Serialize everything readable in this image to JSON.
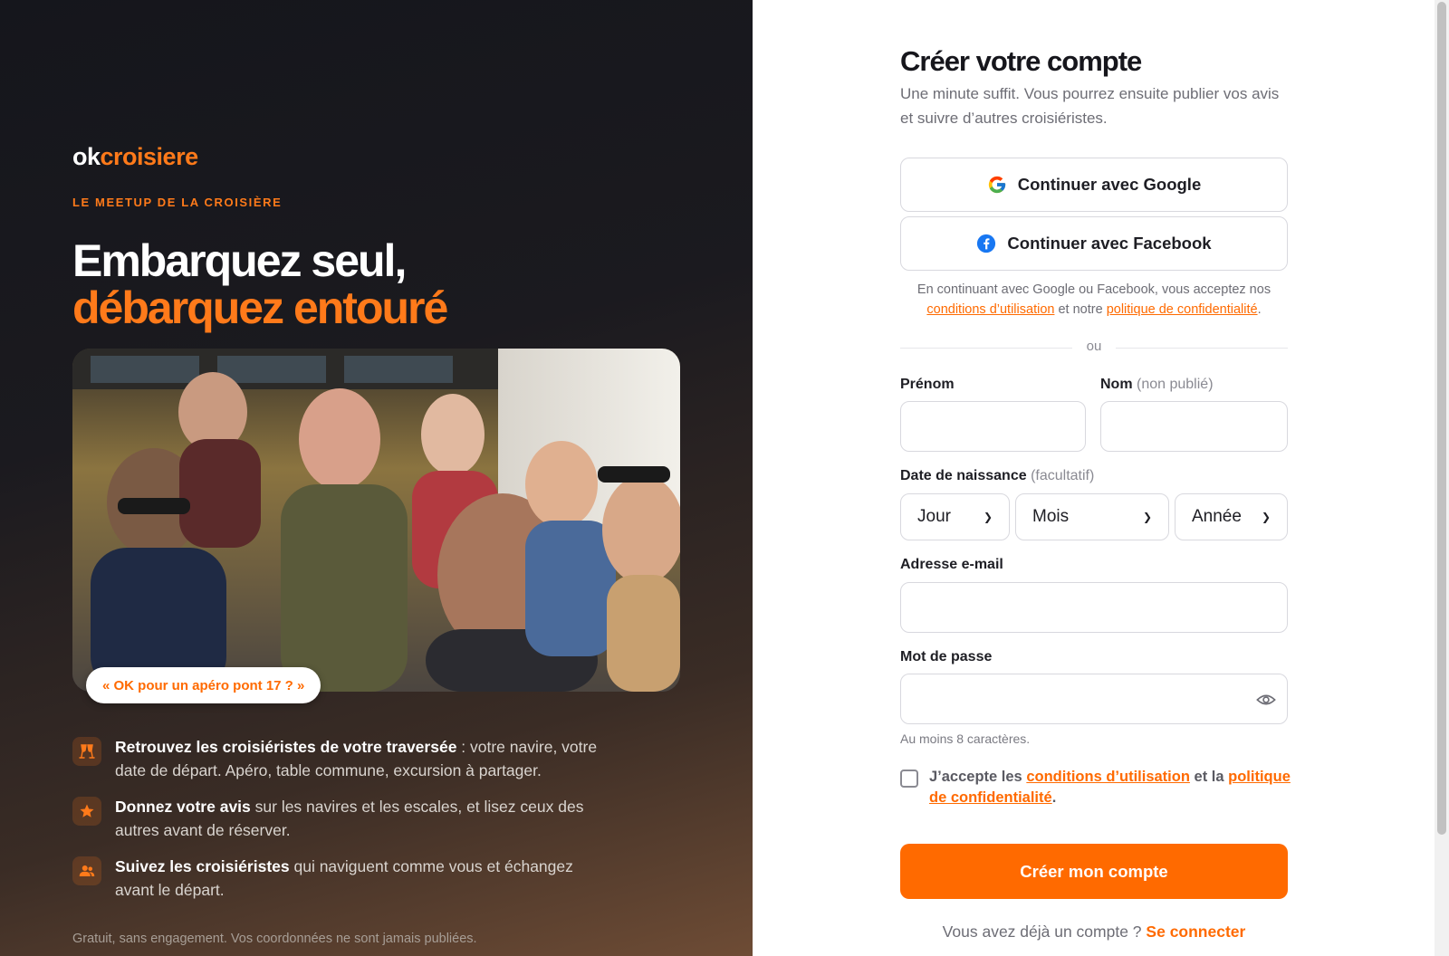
{
  "brand": {
    "logo_ok": "ok",
    "logo_croisiere": "croisiere",
    "kicker": "LE MEETUP DE LA CROISIÈRE"
  },
  "hero": {
    "line1": "Embarquez seul,",
    "line2": "débarquez entouré",
    "photo_caption": "« OK pour un apéro pont 17 ? »"
  },
  "features": [
    {
      "icon": "cheers-icon",
      "bold": "Retrouvez les croisiéristes de votre traversée",
      "rest": " : votre navire, votre date de départ. Apéro, table commune, excursion à partager."
    },
    {
      "icon": "star-icon",
      "bold": "Donnez votre avis",
      "rest": " sur les navires et les escales, et lisez ceux des autres avant de réserver."
    },
    {
      "icon": "people-icon",
      "bold": "Suivez les croisiéristes",
      "rest": " qui naviguent comme vous et échangez avant le départ."
    }
  ],
  "footnote": "Gratuit, sans engagement. Vos coordonnées ne sont jamais publiées.",
  "form": {
    "title": "Créer votre compte",
    "subtitle": "Une minute suffit. Vous pourrez ensuite publier vos avis et suivre d’autres croisiéristes.",
    "google_label": "Continuer avec Google",
    "facebook_label": "Continuer avec Facebook",
    "legal_prefix": "En continuant avec Google ou Facebook, vous acceptez nos",
    "legal_terms": "conditions d’utilisation",
    "legal_middle": "et notre",
    "legal_privacy": "politique de confidentialité",
    "legal_suffix": ".",
    "divider": "ou",
    "firstname_label": "Prénom",
    "lastname_label": "Nom",
    "lastname_note": "(non publié)",
    "dob_label": "Date de naissance",
    "dob_note": "(facultatif)",
    "day": "Jour",
    "month": "Mois",
    "year": "Année",
    "email_label": "Adresse e-mail",
    "password_label": "Mot de passe",
    "password_hint": "Au moins 8 caractères.",
    "consent_prefix": "J’accepte les",
    "consent_terms": "conditions d’utilisation",
    "consent_middle": "et la",
    "consent_privacy": "politique de confidentialité",
    "consent_suffix": ".",
    "submit": "Créer mon compte",
    "signin_prefix": "Vous avez déjà un compte ?",
    "signin_link": "Se connecter"
  },
  "colors": {
    "accent": "#ff6a00",
    "accent_light": "#ff7a1a",
    "dark_bg": "#15161c",
    "text": "#1e1e24",
    "muted": "#6d6d75",
    "border": "#d8d8de"
  }
}
